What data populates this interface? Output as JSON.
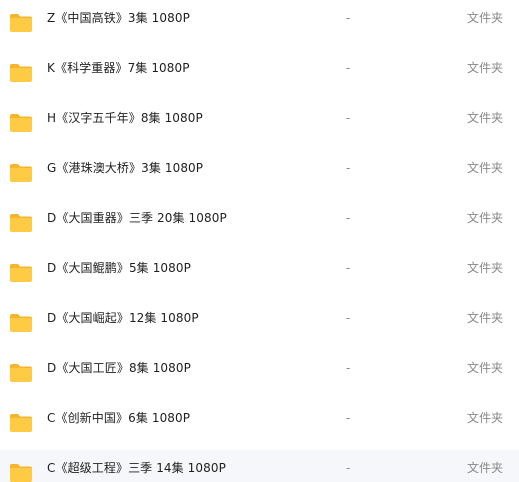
{
  "colors": {
    "folder_body": "#FFCB45",
    "folder_tab": "#F5B52F",
    "text_primary": "#1F1F1F",
    "text_secondary": "#8A8A8A",
    "row_hover_bg": "#F5F7FA"
  },
  "files": [
    {
      "icon": "folder-icon",
      "name": "Z《中国高铁》3集 1080P",
      "size": "-",
      "type": "文件夹"
    },
    {
      "icon": "folder-icon",
      "name": "K《科学重器》7集 1080P",
      "size": "-",
      "type": "文件夹"
    },
    {
      "icon": "folder-icon",
      "name": "H《汉字五千年》8集 1080P",
      "size": "-",
      "type": "文件夹"
    },
    {
      "icon": "folder-icon",
      "name": "G《港珠澳大桥》3集 1080P",
      "size": "-",
      "type": "文件夹"
    },
    {
      "icon": "folder-icon",
      "name": "D《大国重器》三季 20集 1080P",
      "size": "-",
      "type": "文件夹"
    },
    {
      "icon": "folder-icon",
      "name": "D《大国鲲鹏》5集 1080P",
      "size": "-",
      "type": "文件夹"
    },
    {
      "icon": "folder-icon",
      "name": "D《大国崛起》12集 1080P",
      "size": "-",
      "type": "文件夹"
    },
    {
      "icon": "folder-icon",
      "name": "D《大国工匠》8集 1080P",
      "size": "-",
      "type": "文件夹"
    },
    {
      "icon": "folder-icon",
      "name": "C《创新中国》6集 1080P",
      "size": "-",
      "type": "文件夹"
    },
    {
      "icon": "folder-icon",
      "name": "C《超级工程》三季 14集 1080P",
      "size": "-",
      "type": "文件夹"
    }
  ]
}
